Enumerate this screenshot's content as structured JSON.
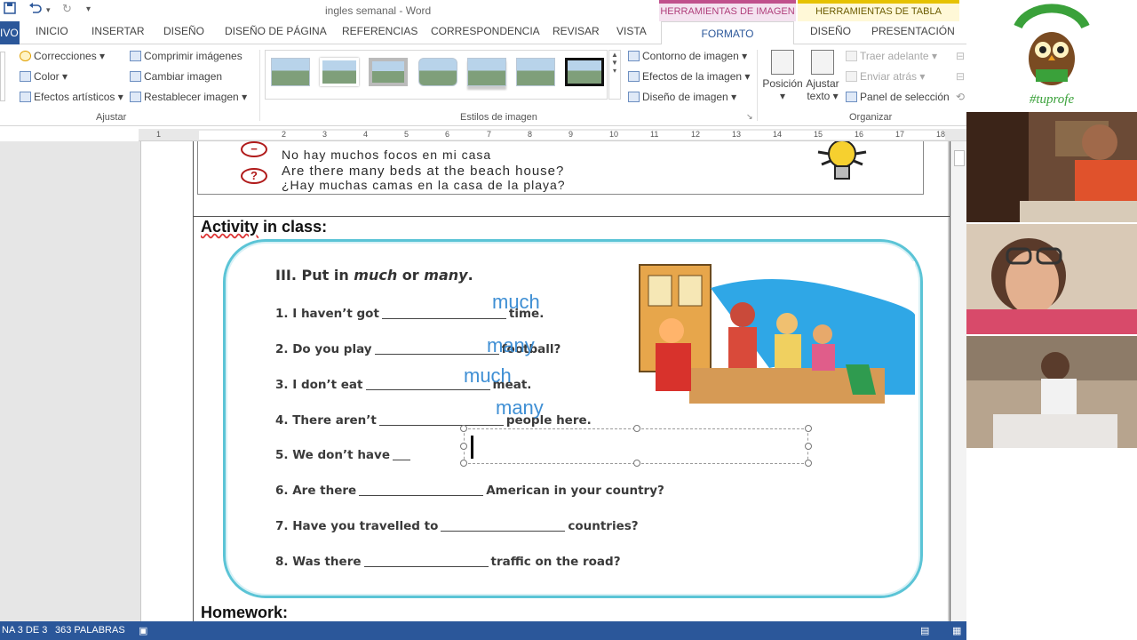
{
  "window": {
    "title": "ingles semanal - Word",
    "context_groups": {
      "image_tools": "HERRAMIENTAS DE IMAGEN",
      "table_tools": "HERRAMIENTAS DE TABLA"
    },
    "colors": {
      "word_blue": "#2b579a",
      "answer_blue": "#3f8fd4",
      "worksheet_border": "#5bc4d6"
    }
  },
  "tabs": {
    "archivo": "IVO",
    "inicio": "INICIO",
    "insertar": "INSERTAR",
    "diseno": "DISEÑO",
    "diseno_pagina": "DISEÑO DE PÁGINA",
    "referencias": "REFERENCIAS",
    "correspondencia": "CORRESPONDENCIA",
    "revisar": "REVISAR",
    "vista": "VISTA",
    "formato": "FORMATO",
    "diseno_tabla": "DISEÑO",
    "presentacion": "PRESENTACIÓN"
  },
  "ribbon": {
    "ajustar": {
      "correcciones": "Correcciones",
      "color": "Color",
      "efectos_artisticos": "Efectos artísticos",
      "comprimir": "Comprimir imágenes",
      "cambiar": "Cambiar imagen",
      "restablecer": "Restablecer imagen",
      "label": "Ajustar"
    },
    "estilos": {
      "label": "Estilos de imagen",
      "contorno": "Contorno de imagen",
      "efectos": "Efectos de la imagen",
      "diseno": "Diseño de imagen"
    },
    "organizar": {
      "posicion": "Posición",
      "ajustar_texto_1": "Ajustar",
      "ajustar_texto_2": "texto",
      "traer": "Traer adelante",
      "enviar": "Enviar atrás",
      "panel": "Panel de selección",
      "label": "Organizar"
    }
  },
  "document": {
    "example_es": "No hay muchos focos en mi casa",
    "example_q_en": "Are there many beds at the beach house?",
    "example_q_es": "¿Hay muchas camas en la casa de la playa?",
    "activity_title_a": "Activity",
    "activity_title_b": " in class:",
    "homework": "Homework:",
    "worksheet": {
      "heading_a": "III. Put in ",
      "heading_much": "much",
      "heading_or": " or ",
      "heading_many": "many",
      "heading_end": ".",
      "items": [
        {
          "pre": "1. I haven’t got",
          "post": "time.",
          "answer": "much"
        },
        {
          "pre": "2. Do you play",
          "post": "football?",
          "answer": "many"
        },
        {
          "pre": "3. I don’t eat",
          "post": "meat.",
          "answer": "much"
        },
        {
          "pre": "4. There aren’t",
          "post": "people here.",
          "answer": "many"
        },
        {
          "pre": "5. We don’t have",
          "post": "",
          "answer": ""
        },
        {
          "pre": "6. Are there",
          "post": "American in your country?",
          "answer": ""
        },
        {
          "pre": "7. Have you travelled to",
          "post": "countries?",
          "answer": ""
        },
        {
          "pre": "8. Was there",
          "post": "traffic on the road?",
          "answer": ""
        }
      ]
    }
  },
  "status": {
    "page": "NA 3 DE 3",
    "words": "363 PALABRAS"
  },
  "meeting": {
    "logo_text": "#tuprofe"
  }
}
